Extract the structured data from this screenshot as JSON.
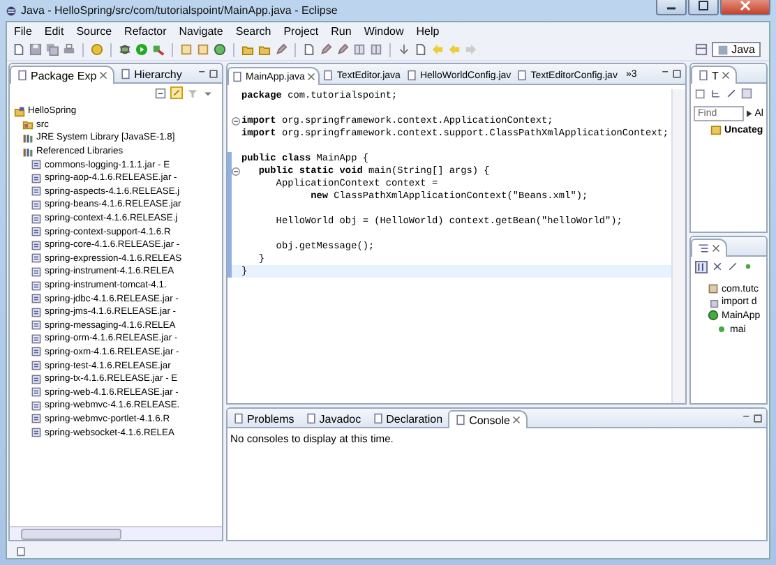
{
  "window": {
    "title": "Java - HelloSpring/src/com/tutorialspoint/MainApp.java - Eclipse"
  },
  "menu": [
    "File",
    "Edit",
    "Source",
    "Refactor",
    "Navigate",
    "Search",
    "Project",
    "Run",
    "Window",
    "Help"
  ],
  "perspective": {
    "label": "Java",
    "selected": true
  },
  "package_explorer": {
    "tabs": [
      {
        "label": "Package Exp",
        "selected": true
      },
      {
        "label": "Hierarchy",
        "selected": false
      }
    ],
    "tree": [
      {
        "label": "HelloSpring",
        "kind": "project",
        "children": [
          {
            "label": "src",
            "kind": "folder"
          },
          {
            "label": "JRE System Library [JavaSE-1.8]",
            "kind": "library"
          },
          {
            "label": "Referenced Libraries",
            "kind": "library",
            "children": [
              {
                "label": "commons-logging-1.1.1.jar - E",
                "kind": "jar"
              },
              {
                "label": "spring-aop-4.1.6.RELEASE.jar -",
                "kind": "jar"
              },
              {
                "label": "spring-aspects-4.1.6.RELEASE.j",
                "kind": "jar"
              },
              {
                "label": "spring-beans-4.1.6.RELEASE.jar",
                "kind": "jar"
              },
              {
                "label": "spring-context-4.1.6.RELEASE.j",
                "kind": "jar"
              },
              {
                "label": "spring-context-support-4.1.6.R",
                "kind": "jar"
              },
              {
                "label": "spring-core-4.1.6.RELEASE.jar -",
                "kind": "jar"
              },
              {
                "label": "spring-expression-4.1.6.RELEAS",
                "kind": "jar"
              },
              {
                "label": "spring-instrument-4.1.6.RELEA",
                "kind": "jar"
              },
              {
                "label": "spring-instrument-tomcat-4.1.",
                "kind": "jar"
              },
              {
                "label": "spring-jdbc-4.1.6.RELEASE.jar -",
                "kind": "jar"
              },
              {
                "label": "spring-jms-4.1.6.RELEASE.jar -",
                "kind": "jar"
              },
              {
                "label": "spring-messaging-4.1.6.RELEA",
                "kind": "jar"
              },
              {
                "label": "spring-orm-4.1.6.RELEASE.jar -",
                "kind": "jar"
              },
              {
                "label": "spring-oxm-4.1.6.RELEASE.jar -",
                "kind": "jar"
              },
              {
                "label": "spring-test-4.1.6.RELEASE.jar",
                "kind": "jar"
              },
              {
                "label": "spring-tx-4.1.6.RELEASE.jar - E",
                "kind": "jar"
              },
              {
                "label": "spring-web-4.1.6.RELEASE.jar -",
                "kind": "jar"
              },
              {
                "label": "spring-webmvc-4.1.6.RELEASE.",
                "kind": "jar"
              },
              {
                "label": "spring-webmvc-portlet-4.1.6.R",
                "kind": "jar"
              },
              {
                "label": "spring-websocket-4.1.6.RELEA",
                "kind": "jar"
              }
            ]
          }
        ]
      }
    ]
  },
  "editor": {
    "tabs": [
      {
        "label": "MainApp.java",
        "selected": true
      },
      {
        "label": "TextEditor.java",
        "selected": false
      },
      {
        "label": "HelloWorldConfig.jav",
        "selected": false
      },
      {
        "label": "TextEditorConfig.jav",
        "selected": false
      }
    ],
    "overflow": "»3",
    "blocks": [
      {
        "range_marked": false,
        "lines": [
          {
            "text": "**package** com.tutorialspoint;",
            "foldable": false,
            "current": false
          }
        ]
      },
      {
        "range_marked": false,
        "lines": [
          {
            "text": "**import** org.springframework.context.ApplicationContext;",
            "foldable": true,
            "current": false
          },
          {
            "text": "**import** org.springframework.context.support.ClassPathXmlApplicationContext;",
            "foldable": false,
            "current": false
          }
        ]
      },
      {
        "range_marked": true,
        "lines": [
          {
            "text": "**public class** MainApp {",
            "foldable": false,
            "current": false
          },
          {
            "text": "   **public static void** main(String[] args) {",
            "foldable": true,
            "current": false
          },
          {
            "text": "      ApplicationContext context =",
            "foldable": false,
            "current": false
          },
          {
            "text": "            **new** ClassPathXmlApplicationContext(\"Beans.xml\");",
            "foldable": false,
            "current": false
          }
        ]
      },
      {
        "range_marked": true,
        "lines": [
          {
            "text": "      HelloWorld obj = (HelloWorld) context.getBean(\"helloWorld\");",
            "foldable": false,
            "current": false
          }
        ]
      },
      {
        "range_marked": true,
        "lines": [
          {
            "text": "      obj.getMessage();",
            "foldable": false,
            "current": false
          },
          {
            "text": "   }",
            "foldable": false,
            "current": false
          },
          {
            "text": "}",
            "foldable": false,
            "current": true
          }
        ]
      }
    ]
  },
  "task_list": {
    "tab_label": "T",
    "find_placeholder": "Find",
    "filter": "Al",
    "items": [
      {
        "label": "Uncateg"
      }
    ]
  },
  "outline": {
    "tree": [
      {
        "label": "com.tutc",
        "kind": "package"
      },
      {
        "label": "import d",
        "kind": "imports"
      },
      {
        "label": "MainApp",
        "kind": "class",
        "children": [
          {
            "label": "mai",
            "kind": "method"
          }
        ]
      }
    ]
  },
  "bottom_panel": {
    "tabs": [
      {
        "label": "Problems",
        "selected": false
      },
      {
        "label": "Javadoc",
        "selected": false
      },
      {
        "label": "Declaration",
        "selected": false
      },
      {
        "label": "Console",
        "selected": true
      }
    ],
    "message": "No consoles to display at this time."
  }
}
